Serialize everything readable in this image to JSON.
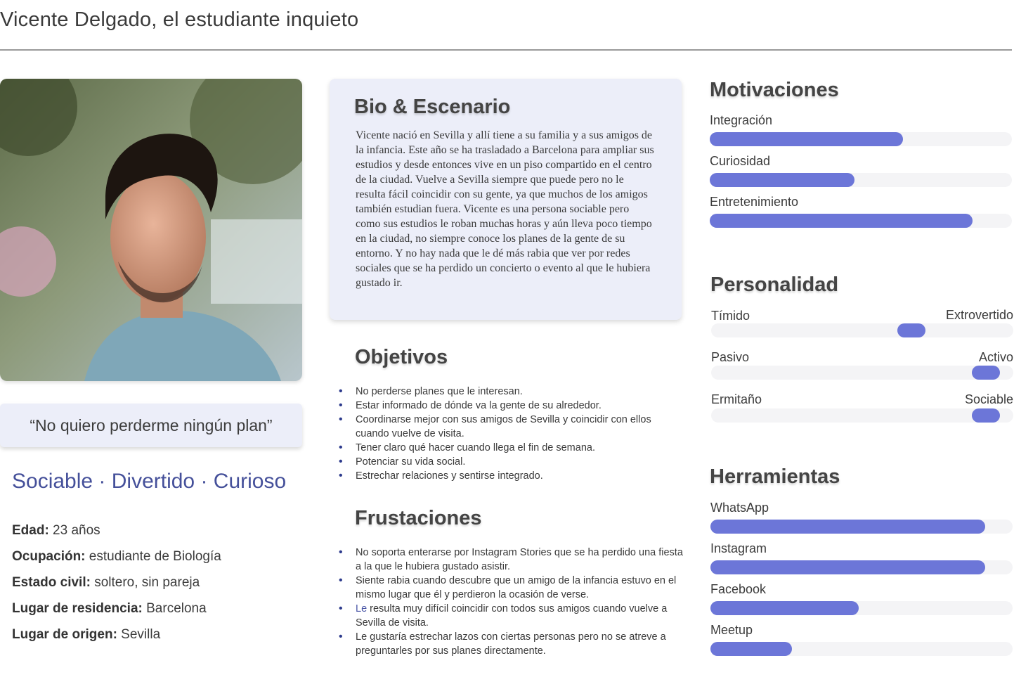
{
  "title": "Vicente Delgado, el estudiante inquieto",
  "quote": "“No quiero perderme ningún plan”",
  "traits": "Sociable · Divertido · Curioso",
  "facts": [
    {
      "label": "Edad:",
      "value": " 23 años"
    },
    {
      "label": "Ocupación:",
      "value": " estudiante de Biología"
    },
    {
      "label": "Estado civil:",
      "value": " soltero, sin pareja"
    },
    {
      "label": "Lugar de residencia:",
      "value": " Barcelona"
    },
    {
      "label": "Lugar de origen:",
      "value": " Sevilla"
    }
  ],
  "bio": {
    "heading": "Bio & Escenario",
    "text": "Vicente nació en Sevilla y allí tiene a su familia y a sus amigos de la infancia. Este año se ha trasladado a Barcelona para ampliar sus estudios y desde entonces vive en un piso compartido en el centro de la ciudad. Vuelve a Sevilla siempre que puede pero no le resulta fácil coincidir con su gente, ya que muchos de los amigos también estudian fuera. Vicente es una persona sociable pero como sus estudios le roban muchas horas y aún lleva poco tiempo en la ciudad, no siempre conoce los planes de la gente de su entorno. Y no hay nada que le dé más rabia que ver por redes sociales que se ha perdido un concierto o evento al que le hubiera gustado ir."
  },
  "objetivos": {
    "heading": "Objetivos",
    "items": [
      "No perderse planes que le interesan.",
      "Estar informado de dónde va la gente de su alrededor.",
      "Coordinarse mejor con sus amigos de Sevilla y coincidir con ellos cuando vuelve de visita.",
      "Tener claro qué hacer cuando llega el fin de semana.",
      "Potenciar su vida social.",
      "Estrechar relaciones y sentirse integrado."
    ]
  },
  "frustraciones": {
    "heading": "Frustaciones",
    "items": [
      {
        "lead": "",
        "text": "No soporta enterarse por Instagram Stories que se ha perdido una fiesta a la que le hubiera gustado asistir."
      },
      {
        "lead": "",
        "text": "Siente rabia cuando descubre que un amigo de la infancia estuvo en el mismo lugar que él y perdieron la ocasión de verse."
      },
      {
        "lead": "Le",
        "text": " resulta muy difícil coincidir con todos sus amigos cuando vuelve a Sevilla de visita."
      },
      {
        "lead": "",
        "text": "Le gustaría estrechar lazos con ciertas personas pero no se atreve a preguntarles por sus planes directamente."
      }
    ]
  },
  "motivaciones": {
    "heading": "Motivaciones",
    "items": [
      {
        "label": "Integración",
        "level": 0.64
      },
      {
        "label": "Curiosidad",
        "level": 0.48
      },
      {
        "label": "Entretenimiento",
        "level": 0.87
      }
    ]
  },
  "personalidad": {
    "heading": "Personalidad",
    "items": [
      {
        "left": "Tímido",
        "right": "Extrovertido",
        "position": 0.68
      },
      {
        "left": "Pasivo",
        "right": "Activo",
        "position": 0.95
      },
      {
        "left": "Ermitaño",
        "right": "Sociable",
        "position": 0.95
      }
    ]
  },
  "herramientas": {
    "heading": "Herramientas",
    "items": [
      {
        "label": "WhatsApp",
        "level": 0.91
      },
      {
        "label": "Instagram",
        "level": 0.91
      },
      {
        "label": "Facebook",
        "level": 0.49
      },
      {
        "label": "Meetup",
        "level": 0.27
      }
    ]
  },
  "colors": {
    "accent": "#6c76d8",
    "card": "#eceef9",
    "traits": "#45509a"
  }
}
